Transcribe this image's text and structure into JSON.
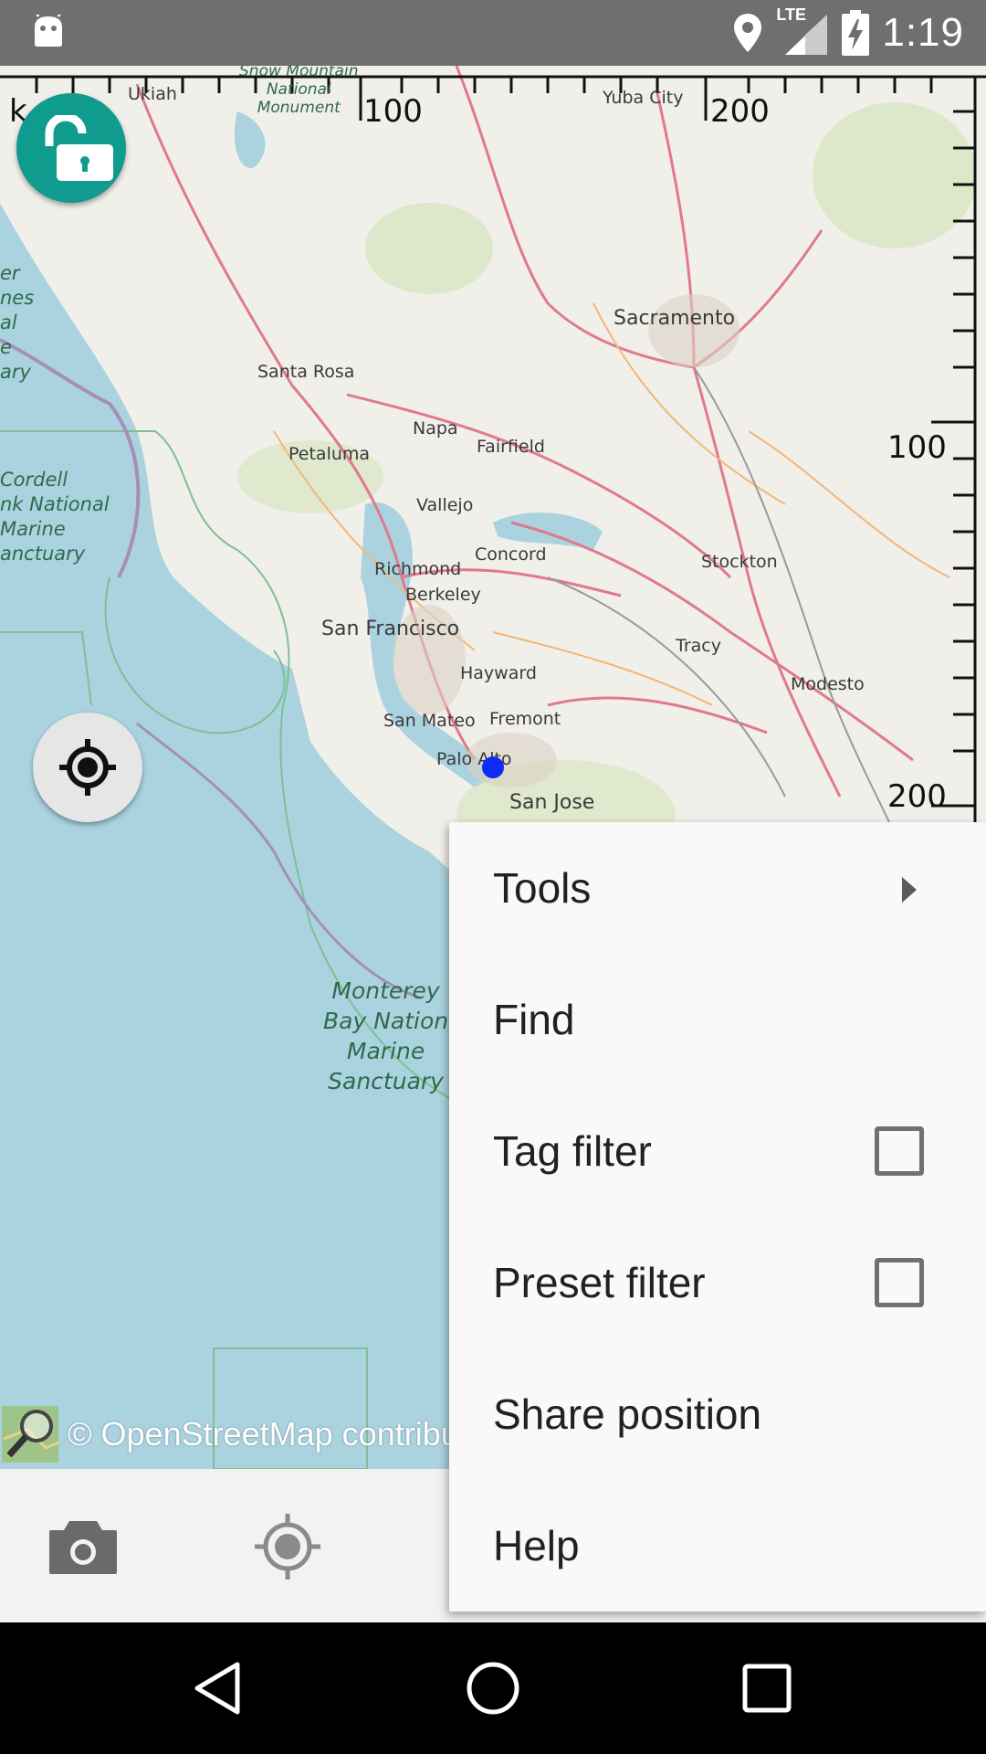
{
  "status_bar": {
    "time": "1:19",
    "network": "LTE",
    "icons": [
      "android-icon",
      "location-pin-icon",
      "signal-icon",
      "battery-charging-icon"
    ]
  },
  "map": {
    "attribution": "© OpenStreetMap contribu",
    "scale_top": [
      "k",
      "100",
      "200"
    ],
    "scale_right": [
      "100",
      "200"
    ],
    "places": {
      "ukiah": "Ukiah",
      "snow_mountain": "Snow Mountain",
      "national": "National",
      "monument": "Monument",
      "yuba_city": "Yuba City",
      "sacramento": "Sacramento",
      "santa_rosa": "Santa Rosa",
      "napa": "Napa",
      "petaluma": "Petaluma",
      "fairfield": "Fairfield",
      "vallejo": "Vallejo",
      "concord": "Concord",
      "richmond": "Richmond",
      "berkeley": "Berkeley",
      "san_francisco": "San Francisco",
      "hayward": "Hayward",
      "fremont": "Fremont",
      "san_mateo": "San Mateo",
      "palo_alto": "Palo Alto",
      "san_jose": "San Jose",
      "stockton": "Stockton",
      "tracy": "Tracy",
      "modesto": "Modesto"
    },
    "water_labels": {
      "cordell": [
        "Cordell",
        "nk National",
        "Marine",
        "anctuary"
      ],
      "monterey": [
        "Monterey",
        "Bay Nation",
        "Marine",
        "Sanctuary"
      ],
      "left_edge": [
        "er",
        "nes",
        "al",
        "e",
        "ary"
      ]
    }
  },
  "toolbar": {
    "buttons": [
      "camera-icon",
      "gps-icon"
    ]
  },
  "menu": {
    "items": [
      {
        "label": "Tools",
        "type": "submenu"
      },
      {
        "label": "Find",
        "type": "action"
      },
      {
        "label": "Tag filter",
        "type": "checkbox",
        "checked": false
      },
      {
        "label": "Preset filter",
        "type": "checkbox",
        "checked": false
      },
      {
        "label": "Share position",
        "type": "action"
      },
      {
        "label": "Help",
        "type": "action"
      }
    ]
  },
  "nav_bar": {
    "buttons": [
      "back-icon",
      "home-icon",
      "recents-icon"
    ]
  },
  "colors": {
    "fab_accent": "#0f9b8e",
    "status_bar": "#6f6f6f",
    "water": "#aad3df",
    "land": "#f1efe9",
    "position_dot": "#0b2cf5"
  }
}
